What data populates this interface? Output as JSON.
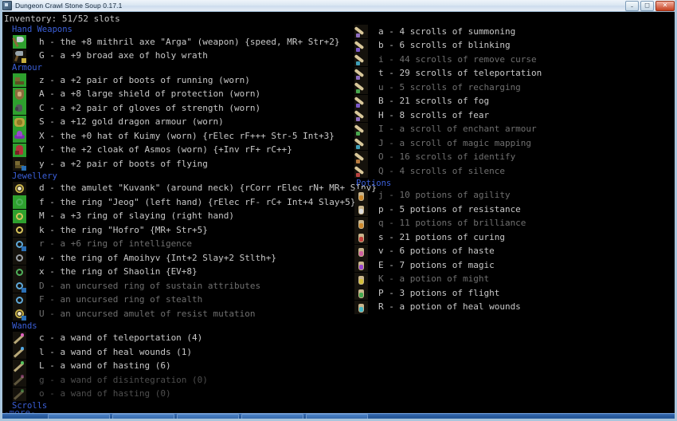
{
  "window": {
    "title": "Dungeon Crawl Stone Soup 0.17.1",
    "app_icon": "crawl-icon",
    "controls": {
      "minimize": "–",
      "maximize": "□",
      "close": "✕"
    }
  },
  "colors": {
    "background": "#000000",
    "item_text": "#c9c9c9",
    "item_text_dim": "#6f6f6f",
    "section_header": "#3b5fd9",
    "more_prompt": "#2f56c8",
    "equipped_tile": "#2ea02e",
    "titlebar": "#dbe7f2",
    "window_border": "#a9c6dd"
  },
  "header": {
    "text": "Inventory: 51/52 slots"
  },
  "more_prompt": "-more-",
  "left_column": {
    "sections": [
      {
        "name": "Hand Weapons",
        "items": [
          {
            "letter": "h",
            "text": "h - the +8 mithril axe \"Arga\" (weapon) {speed, MR+ Str+2}",
            "tile": "axe",
            "tile_bg": "equipped",
            "dim": false
          },
          {
            "letter": "G",
            "text": "G - a +9 broad axe of holy wrath",
            "tile": "axe2",
            "tile_bg": "dark",
            "dim": false
          }
        ]
      },
      {
        "name": "Armour",
        "items": [
          {
            "letter": "z",
            "text": "z - a +2 pair of boots of running (worn)",
            "tile": "boot",
            "tile_bg": "equipped",
            "dim": false
          },
          {
            "letter": "A",
            "text": "A - a +8 large shield of protection (worn)",
            "tile": "shield",
            "tile_bg": "equipped",
            "dim": false
          },
          {
            "letter": "C",
            "text": "C - a +2 pair of gloves of strength (worn)",
            "tile": "glove",
            "tile_bg": "equipped",
            "dim": false
          },
          {
            "letter": "S",
            "text": "S - a +12 gold dragon armour (worn)",
            "tile": "armour",
            "tile_bg": "equipped",
            "dim": false
          },
          {
            "letter": "X",
            "text": "X - the +0 hat of Kuimy (worn) {rElec rF+++ Str-5 Int+3}",
            "tile": "hat",
            "tile_bg": "equipped",
            "dim": false
          },
          {
            "letter": "Y",
            "text": "Y - the +2 cloak of Asmos (worn) {+Inv rF+ rC++}",
            "tile": "cloak",
            "tile_bg": "equipped",
            "dim": false
          },
          {
            "letter": "y",
            "text": "y - a +2 pair of boots of flying",
            "tile": "boot",
            "tile_bg": "dark",
            "dim": false
          }
        ]
      },
      {
        "name": "Jewellery",
        "items": [
          {
            "letter": "d",
            "text": "d - the amulet \"Kuvank\" (around neck) {rCorr rElec rN+ MR+ SInv}",
            "tile": "amulet",
            "tile_bg": "dark",
            "dim": false
          },
          {
            "letter": "f",
            "text": "f - the ring \"Jeog\" (left hand) {rElec rF- rC+ Int+4 Slay+5}",
            "tile": "ring-green",
            "tile_bg": "equipped",
            "dim": false
          },
          {
            "letter": "M",
            "text": "M - a +3 ring of slaying (right hand)",
            "tile": "ring-yellow",
            "tile_bg": "equipped",
            "dim": false
          },
          {
            "letter": "k",
            "text": "k - the ring \"Hofro\" {MR+ Str+5}",
            "tile": "ring-yellow",
            "tile_bg": "dark",
            "dim": false
          },
          {
            "letter": "r",
            "text": "r - a +6 ring of intelligence",
            "tile": "ring-blue",
            "tile_bg": "dark",
            "dim": true
          },
          {
            "letter": "w",
            "text": "w - the ring of Amoihyv {Int+2 Slay+2 Stlth+}",
            "tile": "ring-grey",
            "tile_bg": "dark",
            "dim": false
          },
          {
            "letter": "x",
            "text": "x - the ring of Shaolin {EV+8}",
            "tile": "ring-green",
            "tile_bg": "dark",
            "dim": false
          },
          {
            "letter": "D",
            "text": "D - an uncursed ring of sustain attributes",
            "tile": "ring-blue",
            "tile_bg": "dark",
            "dim": true
          },
          {
            "letter": "F",
            "text": "F - an uncursed ring of stealth",
            "tile": "ring-blue",
            "tile_bg": "dark",
            "dim": true
          },
          {
            "letter": "U",
            "text": "U - an uncursed amulet of resist mutation",
            "tile": "amulet",
            "tile_bg": "dark",
            "dim": true
          }
        ]
      },
      {
        "name": "Wands",
        "items": [
          {
            "letter": "c",
            "text": "c - a wand of teleportation (4)",
            "tile": "wand-pink",
            "tile_bg": "dark",
            "dim": false
          },
          {
            "letter": "l",
            "text": "l - a wand of heal wounds (1)",
            "tile": "wand-blue",
            "tile_bg": "dark",
            "dim": false
          },
          {
            "letter": "L",
            "text": "L - a wand of hasting (6)",
            "tile": "wand-green",
            "tile_bg": "dark",
            "dim": false
          },
          {
            "letter": "g",
            "text": "g - a wand of disintegration (0)",
            "tile": "wand-pink-dim",
            "tile_bg": "dark",
            "dim": true
          },
          {
            "letter": "o",
            "text": "o - a wand of hasting (0)",
            "tile": "wand-green-dim",
            "tile_bg": "dark",
            "dim": true
          }
        ]
      },
      {
        "name": "Scrolls",
        "items": []
      },
      {
        "name": "More",
        "items": []
      }
    ]
  },
  "right_column": {
    "sections": [
      {
        "name": "",
        "items": [
          {
            "letter": "a",
            "text": "a - 4 scrolls of summoning",
            "tile": "scroll-purple",
            "tile_bg": "dark",
            "dim": false
          },
          {
            "letter": "b",
            "text": "b - 6 scrolls of blinking",
            "tile": "scroll-blue",
            "tile_bg": "dark",
            "dim": false
          },
          {
            "letter": "i",
            "text": "i - 44 scrolls of remove curse",
            "tile": "scroll-cyan",
            "tile_bg": "dark",
            "dim": true
          },
          {
            "letter": "t",
            "text": "t - 29 scrolls of teleportation",
            "tile": "scroll-purple",
            "tile_bg": "dark",
            "dim": false
          },
          {
            "letter": "u",
            "text": "u - 5 scrolls of recharging",
            "tile": "scroll-green",
            "tile_bg": "dark",
            "dim": true
          },
          {
            "letter": "B",
            "text": "B - 21 scrolls of fog",
            "tile": "scroll-blue",
            "tile_bg": "dark",
            "dim": false
          },
          {
            "letter": "H",
            "text": "H - 8 scrolls of fear",
            "tile": "scroll-purple",
            "tile_bg": "dark",
            "dim": false
          },
          {
            "letter": "I",
            "text": "I - a scroll of enchant armour",
            "tile": "scroll-green",
            "tile_bg": "dark",
            "dim": true
          },
          {
            "letter": "J",
            "text": "J - a scroll of magic mapping",
            "tile": "scroll-blue",
            "tile_bg": "dark",
            "dim": true
          },
          {
            "letter": "O",
            "text": "O - 16 scrolls of identify",
            "tile": "scroll-orange",
            "tile_bg": "dark",
            "dim": true
          },
          {
            "letter": "Q",
            "text": "Q - 4 scrolls of silence",
            "tile": "scroll-red",
            "tile_bg": "dark",
            "dim": true
          }
        ]
      },
      {
        "name": "Potions",
        "items": [
          {
            "letter": "j",
            "text": "j - 10 potions of agility",
            "tile": "potion-orange",
            "tile_bg": "dark",
            "dim": true
          },
          {
            "letter": "p",
            "text": "p - 5 potions of resistance",
            "tile": "potion-white",
            "tile_bg": "dark",
            "dim": false
          },
          {
            "letter": "q",
            "text": "q - 11 potions of brilliance",
            "tile": "potion-orange",
            "tile_bg": "dark",
            "dim": true
          },
          {
            "letter": "s",
            "text": "s - 21 potions of curing",
            "tile": "potion-red",
            "tile_bg": "dark",
            "dim": false
          },
          {
            "letter": "v",
            "text": "v - 6 potions of haste",
            "tile": "potion-pink",
            "tile_bg": "dark",
            "dim": false
          },
          {
            "letter": "E",
            "text": "E - 7 potions of magic",
            "tile": "potion-purple",
            "tile_bg": "dark",
            "dim": false
          },
          {
            "letter": "K",
            "text": "K - a potion of might",
            "tile": "potion-yellow",
            "tile_bg": "dark",
            "dim": true
          },
          {
            "letter": "P",
            "text": "P - 3 potions of flight",
            "tile": "potion-green",
            "tile_bg": "dark",
            "dim": false
          },
          {
            "letter": "R",
            "text": "R - a potion of heal wounds",
            "tile": "potion-cyan",
            "tile_bg": "dark",
            "dim": false
          }
        ]
      }
    ]
  }
}
